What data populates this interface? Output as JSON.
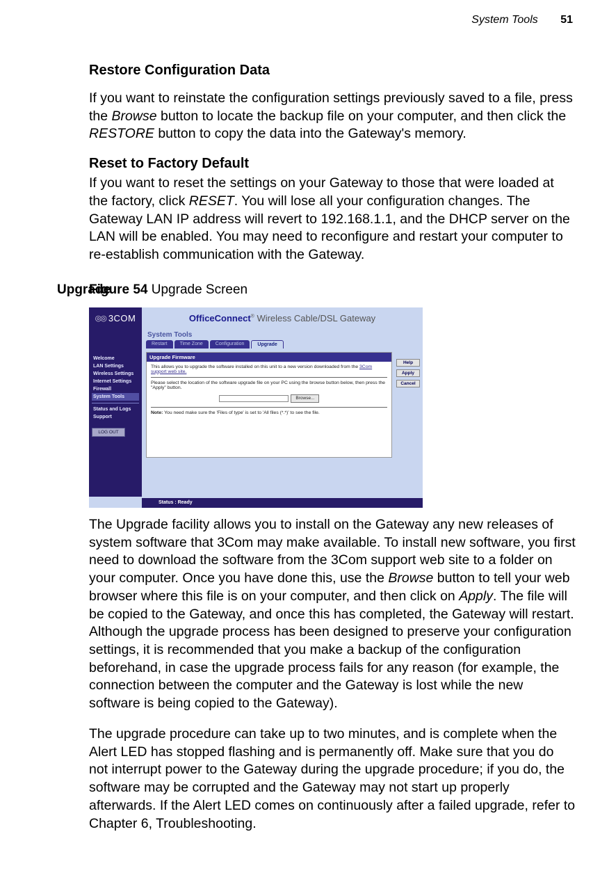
{
  "header": {
    "section": "System Tools",
    "page_number": "51"
  },
  "h_restore": "Restore Configuration Data",
  "p_restore_a": "If you want to reinstate the configuration settings previously saved to a file, press the ",
  "p_restore_b": "Browse",
  "p_restore_c": " button to locate the backup file on your computer, and then click the ",
  "p_restore_d": "RESTORE",
  "p_restore_e": " button to copy the data into the Gateway's memory.",
  "h_reset": "Reset to Factory Default",
  "p_reset_a": "If you want to reset the settings on your Gateway to those that were loaded at the factory, click ",
  "p_reset_b": "RESET",
  "p_reset_c": ". You will lose all your configuration changes. The Gateway LAN IP address will revert to 192.168.1.1, and the DHCP server on the LAN will be enabled. You may need to reconfigure and restart your computer to re-establish communication with the Gateway.",
  "side_upgrade": "Upgrade",
  "fig_num": "Figure 54",
  "fig_caption": "   Upgrade Screen",
  "screenshot": {
    "logo": "3COM",
    "title_brand": "OfficeConnect",
    "title_reg": "®",
    "title_rest": " Wireless Cable/DSL Gateway",
    "section": "System Tools",
    "tabs": [
      "Restart",
      "Time Zone",
      "Configuration",
      "Upgrade"
    ],
    "active_tab_index": 3,
    "sidebar": [
      "Welcome",
      "LAN Settings",
      "Wireless Settings",
      "Internet Settings",
      "Firewall",
      "System Tools"
    ],
    "sidebar2": [
      "Status and Logs",
      "Support"
    ],
    "active_sidebar_index": 5,
    "logout": "LOG OUT",
    "panel_title": "Upgrade Firmware",
    "panel_text1a": "This allows you to upgrade the software installed on this unit to a new version downloaded from the ",
    "panel_text1b": "3Com support web site.",
    "panel_text2": "Please select the location of the software upgrade file on your PC using the browse button below, then press the \"Apply\" button.",
    "browse_label": "Browse...",
    "note_label": "Note:",
    "note_text": " You need make sure the 'Files of type' is set to 'All files (*.*)' to see the file.",
    "right_buttons": [
      "Help",
      "Apply",
      "Cancel"
    ],
    "status": "Status : Ready"
  },
  "p_upgrade1_a": "The Upgrade facility allows you to install on the Gateway any new releases of system software that 3Com may make available. To install new software, you first need to download the software from the 3Com support web site to a folder on your computer. Once you have done this, use the ",
  "p_upgrade1_b": "Browse",
  "p_upgrade1_c": " button to tell your web browser where this file is on your computer, and then click on ",
  "p_upgrade1_d": "Apply",
  "p_upgrade1_e": ". The file will be copied to the Gateway, and once this has completed, the Gateway will restart. Although the upgrade process has been designed to preserve your configuration settings, it is recommended that you make a backup of the configuration beforehand, in case the upgrade process fails for any reason (for example, the connection between the computer and the Gateway is lost while the new software is being copied to the Gateway).",
  "p_upgrade2": "The upgrade procedure can take up to two minutes, and is complete when the Alert LED has stopped flashing and is permanently off. Make sure that you do not interrupt power to the Gateway during the upgrade procedure; if you do, the software may be corrupted and the Gateway may not start up properly afterwards. If the Alert LED comes on continuously after a failed upgrade, refer to Chapter 6, Troubleshooting."
}
